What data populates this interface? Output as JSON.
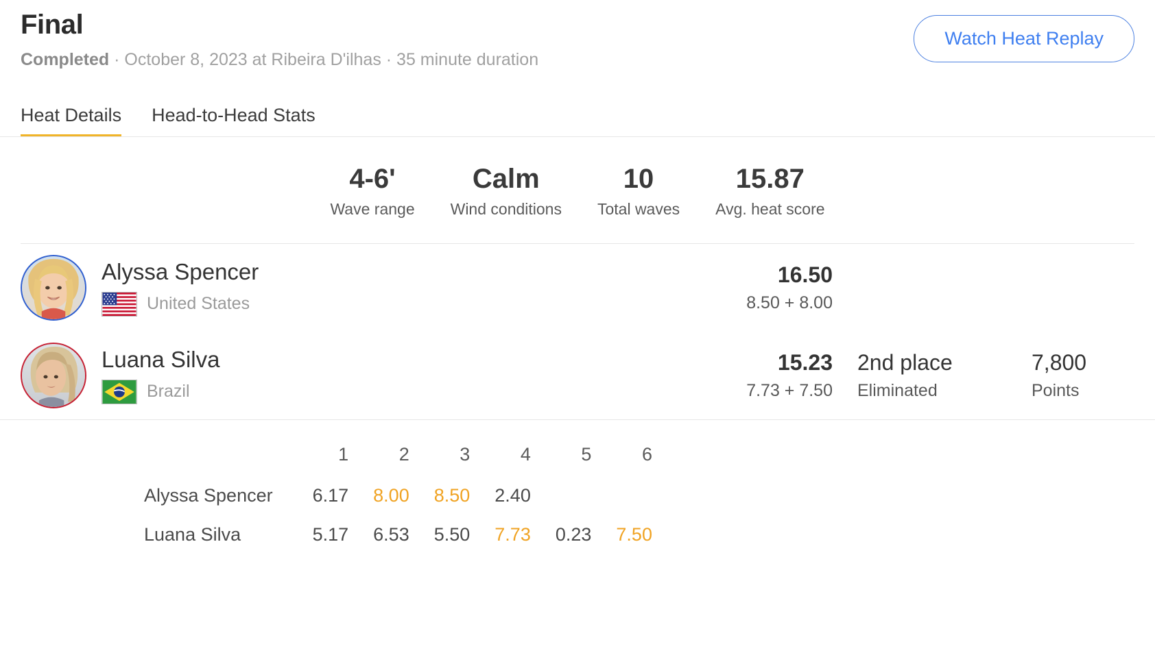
{
  "header": {
    "title": "Final",
    "status": "Completed",
    "subtitle_rest": " · October 8, 2023 at Ribeira D'ilhas · 35 minute duration",
    "replay_button": "Watch Heat Replay",
    "accent_blue": "#3f7ff0"
  },
  "tabs": [
    {
      "label": "Heat Details",
      "active": true
    },
    {
      "label": "Head-to-Head Stats",
      "active": false
    }
  ],
  "tab_accent": "#f0b429",
  "stats": [
    {
      "value": "4-6'",
      "label": "Wave range"
    },
    {
      "value": "Calm",
      "label": "Wind conditions"
    },
    {
      "value": "10",
      "label": "Total waves"
    },
    {
      "value": "15.87",
      "label": "Avg. heat score"
    }
  ],
  "athletes": [
    {
      "name": "Alyssa Spencer",
      "country": "United States",
      "flag": "us-flag-icon",
      "ring_color": "#2f5fd0",
      "total": "16.50",
      "breakdown": "8.50 + 8.00",
      "place": "",
      "place_status": "",
      "points": "",
      "points_label": ""
    },
    {
      "name": "Luana Silva",
      "country": "Brazil",
      "flag": "br-flag-icon",
      "ring_color": "#c62033",
      "total": "15.23",
      "breakdown": "7.73 + 7.50",
      "place": "2nd place",
      "place_status": "Eliminated",
      "points": "7,800",
      "points_label": "Points"
    }
  ],
  "wave_table": {
    "highlight_color": "#f0a323",
    "columns": [
      "1",
      "2",
      "3",
      "4",
      "5",
      "6"
    ],
    "rows": [
      {
        "name": "Alyssa Spencer",
        "scores": [
          {
            "value": "6.17",
            "counting": false
          },
          {
            "value": "8.00",
            "counting": true
          },
          {
            "value": "8.50",
            "counting": true
          },
          {
            "value": "2.40",
            "counting": false
          },
          {
            "value": "",
            "counting": false
          },
          {
            "value": "",
            "counting": false
          }
        ]
      },
      {
        "name": "Luana Silva",
        "scores": [
          {
            "value": "5.17",
            "counting": false
          },
          {
            "value": "6.53",
            "counting": false
          },
          {
            "value": "5.50",
            "counting": false
          },
          {
            "value": "7.73",
            "counting": true
          },
          {
            "value": "0.23",
            "counting": false
          },
          {
            "value": "7.50",
            "counting": true
          }
        ]
      }
    ]
  }
}
